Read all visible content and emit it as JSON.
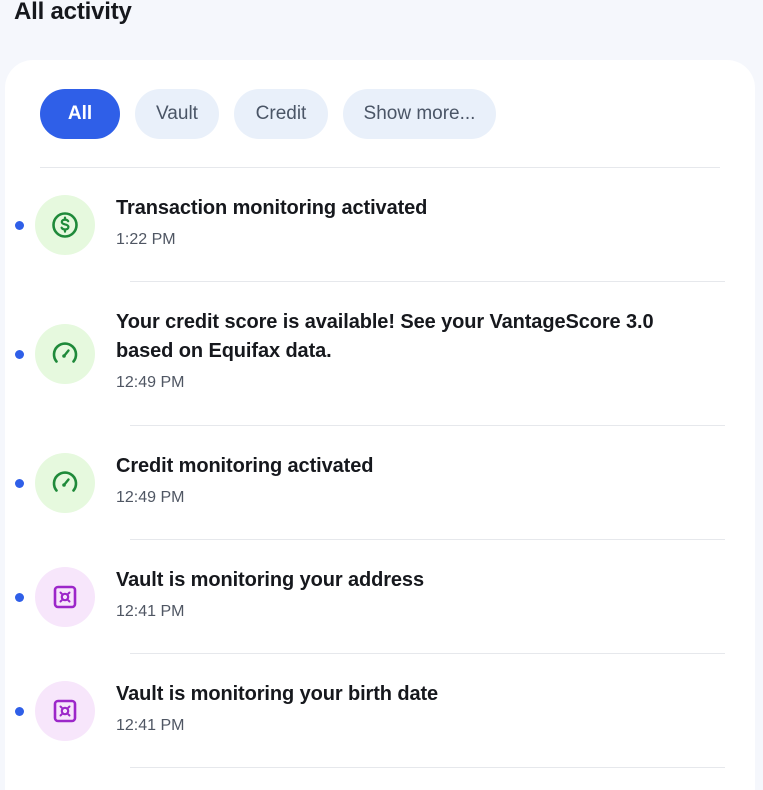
{
  "page": {
    "title": "All activity"
  },
  "filters": [
    {
      "label": "All",
      "active": true
    },
    {
      "label": "Vault",
      "active": false
    },
    {
      "label": "Credit",
      "active": false
    },
    {
      "label": "Show more...",
      "active": false
    }
  ],
  "activities": [
    {
      "title": "Transaction monitoring activated",
      "time": "1:22 PM",
      "icon": "dollar-icon",
      "unread": true
    },
    {
      "title": "Your credit score is available! See your VantageScore 3.0 based on Equifax data.",
      "time": "12:49 PM",
      "icon": "gauge-icon",
      "unread": true
    },
    {
      "title": "Credit monitoring activated",
      "time": "12:49 PM",
      "icon": "gauge-icon",
      "unread": true
    },
    {
      "title": "Vault is monitoring your address",
      "time": "12:41 PM",
      "icon": "vault-icon",
      "unread": true
    },
    {
      "title": "Vault is monitoring your birth date",
      "time": "12:41 PM",
      "icon": "vault-icon",
      "unread": true
    }
  ],
  "colors": {
    "accent": "#2f5fe8",
    "green_icon": "#1f8a3a",
    "green_bg": "#e6f9de",
    "purple_icon": "#9c27c9",
    "purple_bg": "#f7e6fb"
  }
}
